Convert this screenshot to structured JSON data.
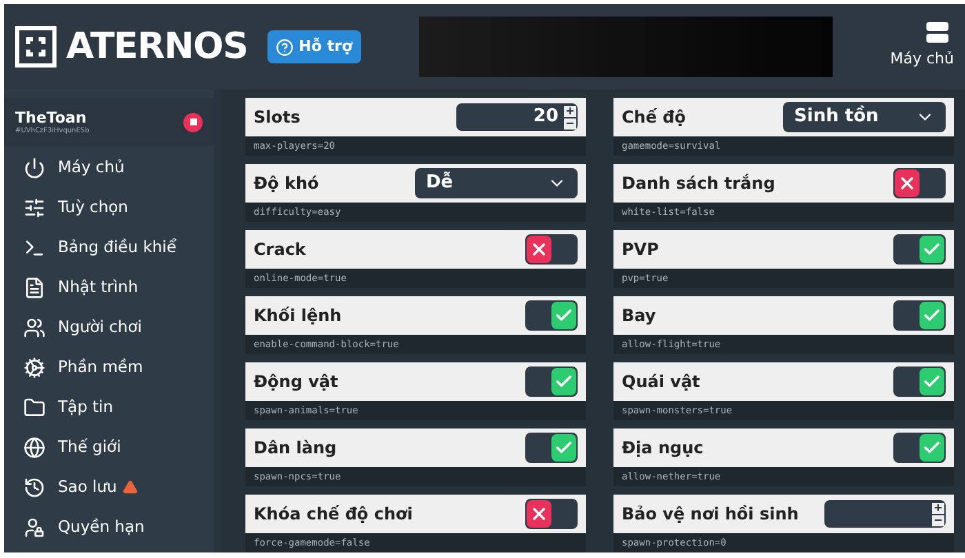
{
  "header": {
    "logo": "ATERNOS",
    "help_button": "Hỗ trợ",
    "server_button": "Máy chủ"
  },
  "account": {
    "name": "TheToan",
    "id": "#UVhCzF3iHvqunE5b"
  },
  "sidebar": {
    "items": [
      {
        "label": "Máy chủ",
        "warning": false
      },
      {
        "label": "Tuỳ chọn",
        "warning": false
      },
      {
        "label": "Bảng điều khiể",
        "warning": false
      },
      {
        "label": "Nhật trình",
        "warning": false
      },
      {
        "label": "Người chơi",
        "warning": false
      },
      {
        "label": "Phần mềm",
        "warning": false
      },
      {
        "label": "Tập tin",
        "warning": false
      },
      {
        "label": "Thế giới",
        "warning": false
      },
      {
        "label": "Sao lưu",
        "warning": true
      },
      {
        "label": "Quyền hạn",
        "warning": false
      }
    ]
  },
  "settings": [
    {
      "kind": "number",
      "label": "Slots",
      "value": "20",
      "key": "max-players=20"
    },
    {
      "kind": "select",
      "label": "Chế độ",
      "value": "Sinh tồn",
      "key": "gamemode=survival"
    },
    {
      "kind": "select",
      "label": "Độ khó",
      "value": "Dễ",
      "key": "difficulty=easy"
    },
    {
      "kind": "toggle",
      "label": "Danh sách trắng",
      "on": false,
      "key": "white-list=false"
    },
    {
      "kind": "toggle",
      "label": "Crack",
      "on": false,
      "key": "online-mode=true"
    },
    {
      "kind": "toggle",
      "label": "PVP",
      "on": true,
      "key": "pvp=true"
    },
    {
      "kind": "toggle",
      "label": "Khối lệnh",
      "on": true,
      "key": "enable-command-block=true"
    },
    {
      "kind": "toggle",
      "label": "Bay",
      "on": true,
      "key": "allow-flight=true"
    },
    {
      "kind": "toggle",
      "label": "Động vật",
      "on": true,
      "key": "spawn-animals=true"
    },
    {
      "kind": "toggle",
      "label": "Quái vật",
      "on": true,
      "key": "spawn-monsters=true"
    },
    {
      "kind": "toggle",
      "label": "Dân làng",
      "on": true,
      "key": "spawn-npcs=true"
    },
    {
      "kind": "toggle",
      "label": "Địa ngục",
      "on": true,
      "key": "allow-nether=true"
    },
    {
      "kind": "toggle",
      "label": "Khóa chế độ chơi",
      "on": false,
      "key": "force-gamemode=false"
    },
    {
      "kind": "number",
      "label": "Bảo vệ nơi hồi sinh",
      "key": "spawn-protection=0"
    }
  ]
}
